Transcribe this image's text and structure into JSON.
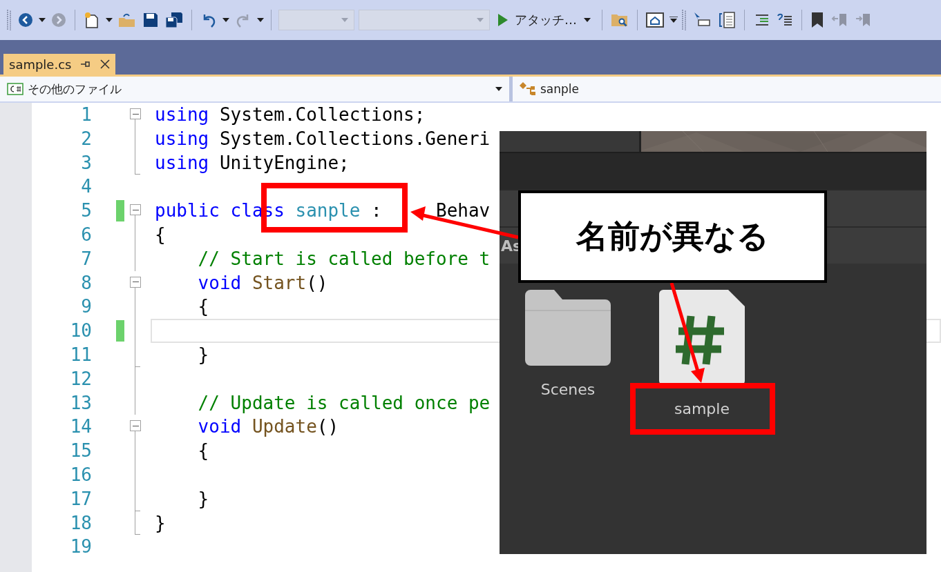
{
  "toolbar": {
    "items": [
      {
        "kind": "grip"
      },
      {
        "kind": "back",
        "disabled": false
      },
      {
        "kind": "caret"
      },
      {
        "kind": "forward",
        "disabled": true
      },
      {
        "kind": "separator"
      },
      {
        "kind": "new-project",
        "disabled": false
      },
      {
        "kind": "caret"
      },
      {
        "kind": "open",
        "disabled": false
      },
      {
        "kind": "save",
        "disabled": false
      },
      {
        "kind": "save-all",
        "disabled": false
      },
      {
        "kind": "separator"
      },
      {
        "kind": "undo",
        "disabled": false
      },
      {
        "kind": "caret"
      },
      {
        "kind": "redo",
        "disabled": true
      },
      {
        "kind": "caret"
      },
      {
        "kind": "separator"
      },
      {
        "kind": "combo"
      },
      {
        "kind": "longcombo"
      },
      {
        "kind": "run",
        "label": "アタッチ…"
      },
      {
        "kind": "separator"
      },
      {
        "kind": "folder-search",
        "disabled": false
      },
      {
        "kind": "separator"
      },
      {
        "kind": "window",
        "disabled": false
      },
      {
        "kind": "overflow"
      },
      {
        "kind": "grip"
      },
      {
        "kind": "pointer",
        "disabled": false
      },
      {
        "kind": "panel",
        "disabled": false
      },
      {
        "kind": "separator"
      },
      {
        "kind": "indent",
        "disabled": false
      },
      {
        "kind": "comment",
        "disabled": false
      },
      {
        "kind": "separator"
      },
      {
        "kind": "bookmark",
        "disabled": false
      },
      {
        "kind": "bookmark-prev",
        "disabled": true
      },
      {
        "kind": "bookmark-next",
        "disabled": true
      }
    ]
  },
  "tabs": [
    {
      "label": "sample.cs",
      "selected": true
    }
  ],
  "nav_bar": {
    "file_scope": "その他のファイル",
    "member": "sanple"
  },
  "editor": {
    "lines": [
      {
        "number": "1",
        "kind": "start",
        "changed": false,
        "current": false,
        "tokens": [
          {
            "kind": "kw",
            "text": "using"
          },
          {
            "kind": "plain",
            "text": " System.Collections;"
          }
        ]
      },
      {
        "number": "2",
        "kind": "inner",
        "changed": false,
        "current": false,
        "tokens": [
          {
            "kind": "kw",
            "text": "using"
          },
          {
            "kind": "plain",
            "text": " System.Collections.Generi"
          }
        ]
      },
      {
        "number": "3",
        "kind": "end",
        "changed": false,
        "current": false,
        "tokens": [
          {
            "kind": "kw",
            "text": "using"
          },
          {
            "kind": "plain",
            "text": " UnityEngine;"
          }
        ]
      },
      {
        "number": "4",
        "kind": "plain",
        "changed": false,
        "current": false
      },
      {
        "number": "5",
        "kind": "start",
        "changed": true,
        "current": false,
        "tokens": [
          {
            "kind": "kw",
            "text": "public class "
          },
          {
            "kind": "type",
            "text": "sanple"
          },
          {
            "kind": "plain",
            "text": " :"
          },
          {
            "kind": "covered",
            "text": "Behav"
          }
        ]
      },
      {
        "number": "6",
        "kind": "inner",
        "changed": false,
        "current": false,
        "tokens": [
          {
            "kind": "plain",
            "text": "{"
          }
        ]
      },
      {
        "number": "7",
        "kind": "inner",
        "changed": false,
        "current": false,
        "tokens": [
          {
            "kind": "comment",
            "text": "    // Start is called before t"
          }
        ]
      },
      {
        "number": "8",
        "kind": "start",
        "changed": false,
        "current": false,
        "tokens": [
          {
            "kind": "kw",
            "text": "    void "
          },
          {
            "kind": "method",
            "text": "Start"
          },
          {
            "kind": "plain",
            "text": "()"
          }
        ]
      },
      {
        "number": "9",
        "kind": "inner",
        "changed": false,
        "current": false,
        "tokens": [
          {
            "kind": "plain",
            "text": "    {"
          }
        ]
      },
      {
        "number": "10",
        "kind": "inner",
        "changed": true,
        "current": true
      },
      {
        "number": "11",
        "kind": "end",
        "changed": false,
        "current": false,
        "tokens": [
          {
            "kind": "plain",
            "text": "    }"
          }
        ]
      },
      {
        "number": "12",
        "kind": "inner",
        "changed": false,
        "current": false
      },
      {
        "number": "13",
        "kind": "inner",
        "changed": false,
        "current": false,
        "tokens": [
          {
            "kind": "comment",
            "text": "    // Update is called once pe"
          }
        ]
      },
      {
        "number": "14",
        "kind": "start",
        "changed": false,
        "current": false,
        "tokens": [
          {
            "kind": "kw",
            "text": "    void "
          },
          {
            "kind": "method",
            "text": "Update"
          },
          {
            "kind": "plain",
            "text": "()"
          }
        ]
      },
      {
        "number": "15",
        "kind": "inner",
        "changed": false,
        "current": false,
        "tokens": [
          {
            "kind": "plain",
            "text": "    {"
          }
        ]
      },
      {
        "number": "16",
        "kind": "inner",
        "changed": false,
        "current": false
      },
      {
        "number": "17",
        "kind": "end",
        "changed": false,
        "current": false,
        "tokens": [
          {
            "kind": "plain",
            "text": "    }"
          }
        ]
      },
      {
        "number": "18",
        "kind": "end",
        "changed": false,
        "current": false,
        "tokens": [
          {
            "kind": "plain",
            "text": "}"
          }
        ]
      },
      {
        "number": "19",
        "kind": "plain",
        "changed": false,
        "current": false
      }
    ]
  },
  "unity_panel": {
    "partial_label": "As",
    "assets": [
      {
        "kind": "folder",
        "name": "Scenes"
      },
      {
        "kind": "script",
        "name": "sample"
      }
    ]
  },
  "annotations": {
    "callout": "名前が異なる"
  }
}
